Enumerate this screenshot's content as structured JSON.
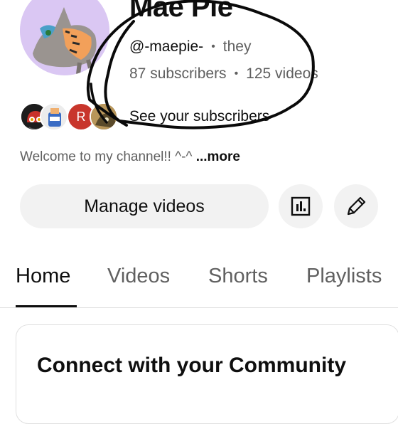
{
  "channel": {
    "name": "Mae Pie",
    "handle": "@-maepie-",
    "pronouns": "they",
    "subscribers": "87 subscribers",
    "videos": "125 videos",
    "dot": "•"
  },
  "subscribers_preview": {
    "label": "See your subscribers",
    "avatars": [
      {
        "icon": "cartoon-cat-avatar",
        "color": "#c8322a"
      },
      {
        "icon": "bottle-avatar",
        "color": "#3a6cc4"
      },
      {
        "icon": "letter-avatar",
        "letter": "R",
        "color": "#c8362c"
      },
      {
        "icon": "creature-avatar",
        "color": "#8a6a3a"
      }
    ]
  },
  "description": {
    "text": "Welcome to my channel!! ^-^",
    "more_label": "...more"
  },
  "actions": {
    "manage_label": "Manage videos",
    "analytics_icon": "analytics-icon",
    "edit_icon": "pencil-icon"
  },
  "tabs": [
    {
      "label": "Home",
      "active": true
    },
    {
      "label": "Videos",
      "active": false
    },
    {
      "label": "Shorts",
      "active": false
    },
    {
      "label": "Playlists",
      "active": false
    }
  ],
  "community_card": {
    "title": "Connect with your Community"
  },
  "colors": {
    "text_primary": "#0f0f0f",
    "text_secondary": "#606060",
    "button_bg": "#f2f2f2",
    "avatar_bg": "#d9c4f2"
  }
}
